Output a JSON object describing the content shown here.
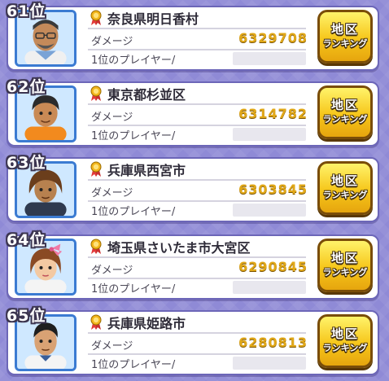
{
  "colors": {
    "background": "#8f8ad6",
    "damage_value": "#e1a819",
    "button": "#f6c61a",
    "avatar_border": "#3b7bd2"
  },
  "rows": [
    {
      "rank": "61位",
      "region": "奈良県明日香村",
      "damage_label": "ダメージ",
      "damage_value": "6329708",
      "player_label": "1位のプレイヤー/",
      "button_line1": "地区",
      "button_line2": "ランキング",
      "avatar_icon": "man-glasses-beard-avatar-icon",
      "medal_icon": "medal-ribbon-icon"
    },
    {
      "rank": "62位",
      "region": "東京都杉並区",
      "damage_label": "ダメージ",
      "damage_value": "6314782",
      "player_label": "1位のプレイヤー/",
      "button_line1": "地区",
      "button_line2": "ランキング",
      "avatar_icon": "boy-orange-shirt-avatar-icon",
      "medal_icon": "medal-ribbon-icon"
    },
    {
      "rank": "63位",
      "region": "兵庫県西宮市",
      "damage_label": "ダメージ",
      "damage_value": "6303845",
      "player_label": "1位のプレイヤー/",
      "button_line1": "地区",
      "button_line2": "ランキング",
      "avatar_icon": "boy-brown-hair-avatar-icon",
      "medal_icon": "medal-ribbon-icon"
    },
    {
      "rank": "64位",
      "region": "埼玉県さいたま市大宮区",
      "damage_label": "ダメージ",
      "damage_value": "6290845",
      "player_label": "1位のプレイヤー/",
      "button_line1": "地区",
      "button_line2": "ランキング",
      "avatar_icon": "girl-pink-bow-avatar-icon",
      "medal_icon": "medal-ribbon-icon"
    },
    {
      "rank": "65位",
      "region": "兵庫県姫路市",
      "damage_label": "ダメージ",
      "damage_value": "6280813",
      "player_label": "1位のプレイヤー/",
      "button_line1": "地区",
      "button_line2": "ランキング",
      "avatar_icon": "man-black-hair-avatar-icon",
      "medal_icon": "medal-ribbon-icon"
    }
  ]
}
